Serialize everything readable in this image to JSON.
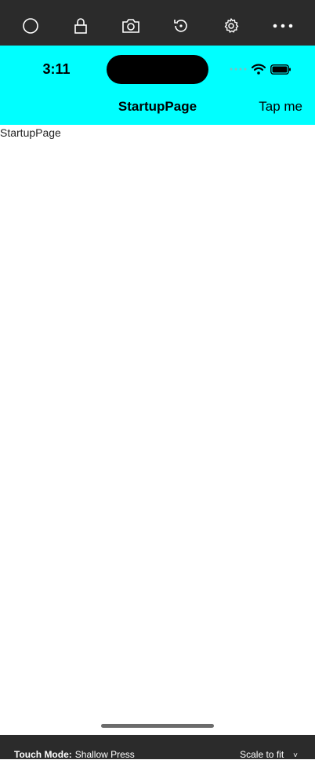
{
  "toolbar": {
    "items": [
      {
        "icon": "circle-icon"
      },
      {
        "icon": "lock-icon"
      },
      {
        "icon": "camera-icon"
      },
      {
        "icon": "rotate-icon"
      },
      {
        "icon": "gear-icon"
      },
      {
        "icon": "more-icon"
      }
    ]
  },
  "status_bar": {
    "time": "3:11",
    "icons": [
      "signal-dots-icon",
      "wifi-icon",
      "battery-icon"
    ]
  },
  "nav_bar": {
    "title": "StartupPage",
    "action_label": "Tap me",
    "background": "#00ffff"
  },
  "content": {
    "label": "StartupPage"
  },
  "bottom_bar": {
    "touch_mode_key": "Touch Mode:",
    "touch_mode_value": "Shallow Press",
    "scale_label": "Scale to fit",
    "scale_chevron": "˅"
  }
}
